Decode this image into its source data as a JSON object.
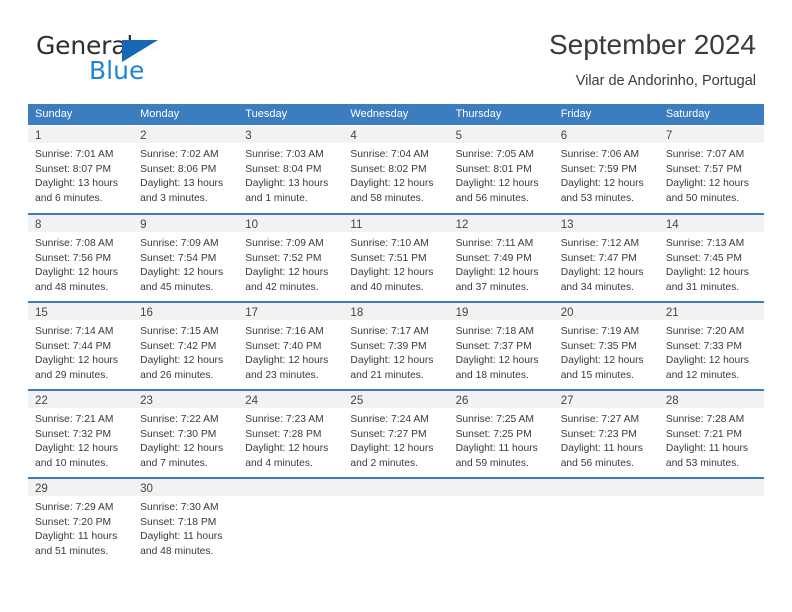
{
  "brand": {
    "name_top": "General",
    "name_bottom": "Blue",
    "color_top": "#2f2f2f",
    "color_bottom": "#1f84d6",
    "triangle_color": "#1668b3"
  },
  "header": {
    "title": "September 2024",
    "subtitle": "Vilar de Andorinho, Portugal"
  },
  "theme": {
    "header_blue": "#3c7dc0",
    "daynum_band": "#f2f2f2",
    "text": "#3a3a3a"
  },
  "calendar": {
    "weekday_headers": [
      "Sunday",
      "Monday",
      "Tuesday",
      "Wednesday",
      "Thursday",
      "Friday",
      "Saturday"
    ],
    "weeks": [
      [
        {
          "day": "1",
          "lines": [
            "Sunrise: 7:01 AM",
            "Sunset: 8:07 PM",
            "Daylight: 13 hours",
            "and 6 minutes."
          ]
        },
        {
          "day": "2",
          "lines": [
            "Sunrise: 7:02 AM",
            "Sunset: 8:06 PM",
            "Daylight: 13 hours",
            "and 3 minutes."
          ]
        },
        {
          "day": "3",
          "lines": [
            "Sunrise: 7:03 AM",
            "Sunset: 8:04 PM",
            "Daylight: 13 hours",
            "and 1 minute."
          ]
        },
        {
          "day": "4",
          "lines": [
            "Sunrise: 7:04 AM",
            "Sunset: 8:02 PM",
            "Daylight: 12 hours",
            "and 58 minutes."
          ]
        },
        {
          "day": "5",
          "lines": [
            "Sunrise: 7:05 AM",
            "Sunset: 8:01 PM",
            "Daylight: 12 hours",
            "and 56 minutes."
          ]
        },
        {
          "day": "6",
          "lines": [
            "Sunrise: 7:06 AM",
            "Sunset: 7:59 PM",
            "Daylight: 12 hours",
            "and 53 minutes."
          ]
        },
        {
          "day": "7",
          "lines": [
            "Sunrise: 7:07 AM",
            "Sunset: 7:57 PM",
            "Daylight: 12 hours",
            "and 50 minutes."
          ]
        }
      ],
      [
        {
          "day": "8",
          "lines": [
            "Sunrise: 7:08 AM",
            "Sunset: 7:56 PM",
            "Daylight: 12 hours",
            "and 48 minutes."
          ]
        },
        {
          "day": "9",
          "lines": [
            "Sunrise: 7:09 AM",
            "Sunset: 7:54 PM",
            "Daylight: 12 hours",
            "and 45 minutes."
          ]
        },
        {
          "day": "10",
          "lines": [
            "Sunrise: 7:09 AM",
            "Sunset: 7:52 PM",
            "Daylight: 12 hours",
            "and 42 minutes."
          ]
        },
        {
          "day": "11",
          "lines": [
            "Sunrise: 7:10 AM",
            "Sunset: 7:51 PM",
            "Daylight: 12 hours",
            "and 40 minutes."
          ]
        },
        {
          "day": "12",
          "lines": [
            "Sunrise: 7:11 AM",
            "Sunset: 7:49 PM",
            "Daylight: 12 hours",
            "and 37 minutes."
          ]
        },
        {
          "day": "13",
          "lines": [
            "Sunrise: 7:12 AM",
            "Sunset: 7:47 PM",
            "Daylight: 12 hours",
            "and 34 minutes."
          ]
        },
        {
          "day": "14",
          "lines": [
            "Sunrise: 7:13 AM",
            "Sunset: 7:45 PM",
            "Daylight: 12 hours",
            "and 31 minutes."
          ]
        }
      ],
      [
        {
          "day": "15",
          "lines": [
            "Sunrise: 7:14 AM",
            "Sunset: 7:44 PM",
            "Daylight: 12 hours",
            "and 29 minutes."
          ]
        },
        {
          "day": "16",
          "lines": [
            "Sunrise: 7:15 AM",
            "Sunset: 7:42 PM",
            "Daylight: 12 hours",
            "and 26 minutes."
          ]
        },
        {
          "day": "17",
          "lines": [
            "Sunrise: 7:16 AM",
            "Sunset: 7:40 PM",
            "Daylight: 12 hours",
            "and 23 minutes."
          ]
        },
        {
          "day": "18",
          "lines": [
            "Sunrise: 7:17 AM",
            "Sunset: 7:39 PM",
            "Daylight: 12 hours",
            "and 21 minutes."
          ]
        },
        {
          "day": "19",
          "lines": [
            "Sunrise: 7:18 AM",
            "Sunset: 7:37 PM",
            "Daylight: 12 hours",
            "and 18 minutes."
          ]
        },
        {
          "day": "20",
          "lines": [
            "Sunrise: 7:19 AM",
            "Sunset: 7:35 PM",
            "Daylight: 12 hours",
            "and 15 minutes."
          ]
        },
        {
          "day": "21",
          "lines": [
            "Sunrise: 7:20 AM",
            "Sunset: 7:33 PM",
            "Daylight: 12 hours",
            "and 12 minutes."
          ]
        }
      ],
      [
        {
          "day": "22",
          "lines": [
            "Sunrise: 7:21 AM",
            "Sunset: 7:32 PM",
            "Daylight: 12 hours",
            "and 10 minutes."
          ]
        },
        {
          "day": "23",
          "lines": [
            "Sunrise: 7:22 AM",
            "Sunset: 7:30 PM",
            "Daylight: 12 hours",
            "and 7 minutes."
          ]
        },
        {
          "day": "24",
          "lines": [
            "Sunrise: 7:23 AM",
            "Sunset: 7:28 PM",
            "Daylight: 12 hours",
            "and 4 minutes."
          ]
        },
        {
          "day": "25",
          "lines": [
            "Sunrise: 7:24 AM",
            "Sunset: 7:27 PM",
            "Daylight: 12 hours",
            "and 2 minutes."
          ]
        },
        {
          "day": "26",
          "lines": [
            "Sunrise: 7:25 AM",
            "Sunset: 7:25 PM",
            "Daylight: 11 hours",
            "and 59 minutes."
          ]
        },
        {
          "day": "27",
          "lines": [
            "Sunrise: 7:27 AM",
            "Sunset: 7:23 PM",
            "Daylight: 11 hours",
            "and 56 minutes."
          ]
        },
        {
          "day": "28",
          "lines": [
            "Sunrise: 7:28 AM",
            "Sunset: 7:21 PM",
            "Daylight: 11 hours",
            "and 53 minutes."
          ]
        }
      ],
      [
        {
          "day": "29",
          "lines": [
            "Sunrise: 7:29 AM",
            "Sunset: 7:20 PM",
            "Daylight: 11 hours",
            "and 51 minutes."
          ]
        },
        {
          "day": "30",
          "lines": [
            "Sunrise: 7:30 AM",
            "Sunset: 7:18 PM",
            "Daylight: 11 hours",
            "and 48 minutes."
          ]
        },
        {
          "day": "",
          "lines": []
        },
        {
          "day": "",
          "lines": []
        },
        {
          "day": "",
          "lines": []
        },
        {
          "day": "",
          "lines": []
        },
        {
          "day": "",
          "lines": []
        }
      ]
    ]
  }
}
